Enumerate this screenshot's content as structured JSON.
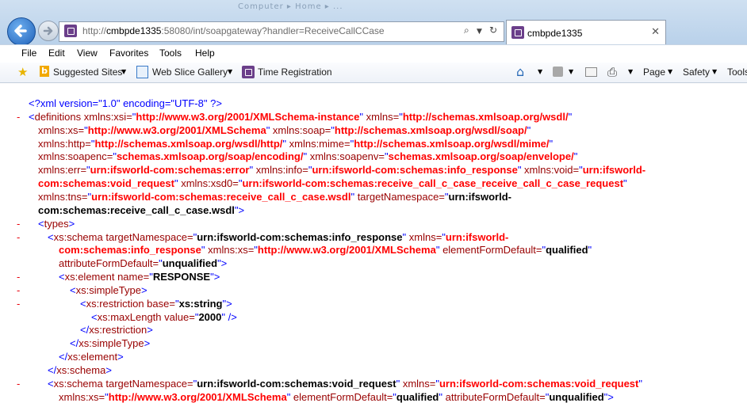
{
  "browser": {
    "address_url_prefix": "http://",
    "address_host": "cmbpde1335",
    "address_rest": ":58080/int/soapgateway?handler=ReceiveCallCCase",
    "tab_title": "cmbpde1335",
    "ghost_title": "Computer ▸ Home ▸ ...",
    "search_icon": "search-icon",
    "refresh_icon": "refresh-icon"
  },
  "menu": [
    "File",
    "Edit",
    "View",
    "Favorites",
    "Tools",
    "Help"
  ],
  "favorites_bar": {
    "suggested_sites": "Suggested Sites",
    "web_slice_gallery": "Web Slice Gallery",
    "time_registration": "Time Registration"
  },
  "command_bar": {
    "page": "Page",
    "safety": "Safety",
    "tools": "Tools"
  },
  "xml_lines": [
    {
      "marker": "",
      "indent": 36,
      "parts": [
        [
          "pi",
          "<?xml version=\"1.0\" encoding=\"UTF-8\" ?>"
        ]
      ]
    },
    {
      "marker": "-",
      "indent": 36,
      "parts": [
        [
          "b",
          "<"
        ],
        [
          "t",
          "definitions"
        ],
        [
          "a",
          " xmlns:xsi="
        ],
        [
          "b",
          "\""
        ],
        [
          "r",
          "http://www.w3.org/2001/XMLSchema-instance"
        ],
        [
          "b",
          "\""
        ],
        [
          "a",
          " xmlns="
        ],
        [
          "b",
          "\""
        ],
        [
          "r",
          "http://schemas.xmlsoap.org/wsdl/"
        ],
        [
          "b",
          "\""
        ]
      ]
    },
    {
      "marker": "",
      "indent": 48,
      "parts": [
        [
          "a",
          "xmlns:xs="
        ],
        [
          "b",
          "\""
        ],
        [
          "r",
          "http://www.w3.org/2001/XMLSchema"
        ],
        [
          "b",
          "\""
        ],
        [
          "a",
          " xmlns:soap="
        ],
        [
          "b",
          "\""
        ],
        [
          "r",
          "http://schemas.xmlsoap.org/wsdl/soap/"
        ],
        [
          "b",
          "\""
        ]
      ]
    },
    {
      "marker": "",
      "indent": 48,
      "parts": [
        [
          "a",
          "xmlns:http="
        ],
        [
          "b",
          "\""
        ],
        [
          "r",
          "http://schemas.xmlsoap.org/wsdl/http/"
        ],
        [
          "b",
          "\""
        ],
        [
          "a",
          " xmlns:mime="
        ],
        [
          "b",
          "\""
        ],
        [
          "r",
          "http://schemas.xmlsoap.org/wsdl/mime/"
        ],
        [
          "b",
          "\""
        ]
      ]
    },
    {
      "marker": "",
      "indent": 48,
      "parts": [
        [
          "a",
          "xmlns:soapenc="
        ],
        [
          "b",
          "\""
        ],
        [
          "r",
          "schemas.xmlsoap.org/soap/encoding/"
        ],
        [
          "b",
          "\""
        ],
        [
          "a",
          " xmlns:soapenv="
        ],
        [
          "b",
          "\""
        ],
        [
          "r",
          "schemas.xmlsoap.org/soap/envelope/"
        ],
        [
          "b",
          "\""
        ]
      ]
    },
    {
      "marker": "",
      "indent": 48,
      "parts": [
        [
          "a",
          "xmlns:err="
        ],
        [
          "b",
          "\""
        ],
        [
          "r",
          "urn:ifsworld-com:schemas:error"
        ],
        [
          "b",
          "\""
        ],
        [
          "a",
          " xmlns:info="
        ],
        [
          "b",
          "\""
        ],
        [
          "r",
          "urn:ifsworld-com:schemas:info_response"
        ],
        [
          "b",
          "\""
        ],
        [
          "a",
          " xmlns:void="
        ],
        [
          "b",
          "\""
        ],
        [
          "r",
          "urn:ifsworld-"
        ]
      ]
    },
    {
      "marker": "",
      "indent": 48,
      "parts": [
        [
          "r",
          "com:schemas:void_request"
        ],
        [
          "b",
          "\""
        ],
        [
          "a",
          " xmlns:xsd0="
        ],
        [
          "b",
          "\""
        ],
        [
          "r",
          "urn:ifsworld-com:schemas:receive_call_c_case_receive_call_c_case_request"
        ],
        [
          "b",
          "\""
        ]
      ]
    },
    {
      "marker": "",
      "indent": 48,
      "parts": [
        [
          "a",
          "xmlns:tns="
        ],
        [
          "b",
          "\""
        ],
        [
          "r",
          "urn:ifsworld-com:schemas:receive_call_c_case.wsdl"
        ],
        [
          "b",
          "\""
        ],
        [
          "a",
          " targetNamespace="
        ],
        [
          "b",
          "\""
        ],
        [
          "v",
          "urn:ifsworld-"
        ]
      ]
    },
    {
      "marker": "",
      "indent": 48,
      "parts": [
        [
          "v",
          "com:schemas:receive_call_c_case.wsdl"
        ],
        [
          "b",
          "\">"
        ]
      ]
    },
    {
      "marker": "-",
      "indent": 48,
      "parts": [
        [
          "b",
          "<"
        ],
        [
          "t",
          "types"
        ],
        [
          "b",
          ">"
        ]
      ]
    },
    {
      "marker": "-",
      "indent": 60,
      "parts": [
        [
          "b",
          "<"
        ],
        [
          "t",
          "xs:schema"
        ],
        [
          "a",
          " targetNamespace="
        ],
        [
          "b",
          "\""
        ],
        [
          "v",
          "urn:ifsworld-com:schemas:info_response"
        ],
        [
          "b",
          "\""
        ],
        [
          "a",
          " xmlns="
        ],
        [
          "b",
          "\""
        ],
        [
          "r",
          "urn:ifsworld-"
        ]
      ]
    },
    {
      "marker": "",
      "indent": 74,
      "parts": [
        [
          "r",
          "com:schemas:info_response"
        ],
        [
          "b",
          "\""
        ],
        [
          "a",
          " xmlns:xs="
        ],
        [
          "b",
          "\""
        ],
        [
          "r",
          "http://www.w3.org/2001/XMLSchema"
        ],
        [
          "b",
          "\""
        ],
        [
          "a",
          " elementFormDefault="
        ],
        [
          "b",
          "\""
        ],
        [
          "v",
          "qualified"
        ],
        [
          "b",
          "\""
        ]
      ]
    },
    {
      "marker": "",
      "indent": 74,
      "parts": [
        [
          "a",
          "attributeFormDefault="
        ],
        [
          "b",
          "\""
        ],
        [
          "v",
          "unqualified"
        ],
        [
          "b",
          "\">"
        ]
      ]
    },
    {
      "marker": "-",
      "indent": 74,
      "parts": [
        [
          "b",
          "<"
        ],
        [
          "t",
          "xs:element"
        ],
        [
          "a",
          " name="
        ],
        [
          "b",
          "\""
        ],
        [
          "v",
          "RESPONSE"
        ],
        [
          "b",
          "\">"
        ]
      ]
    },
    {
      "marker": "-",
      "indent": 88,
      "parts": [
        [
          "b",
          "<"
        ],
        [
          "t",
          "xs:simpleType"
        ],
        [
          "b",
          ">"
        ]
      ]
    },
    {
      "marker": "-",
      "indent": 101,
      "parts": [
        [
          "b",
          "<"
        ],
        [
          "t",
          "xs:restriction"
        ],
        [
          "a",
          " base="
        ],
        [
          "b",
          "\""
        ],
        [
          "v",
          "xs:string"
        ],
        [
          "b",
          "\">"
        ]
      ]
    },
    {
      "marker": "",
      "indent": 115,
      "parts": [
        [
          "b",
          "<"
        ],
        [
          "t",
          "xs:maxLength"
        ],
        [
          "a",
          " value="
        ],
        [
          "b",
          "\""
        ],
        [
          "v",
          "2000"
        ],
        [
          "b",
          "\" />"
        ]
      ]
    },
    {
      "marker": "",
      "indent": 101,
      "parts": [
        [
          "b",
          "</"
        ],
        [
          "t",
          "xs:restriction"
        ],
        [
          "b",
          ">"
        ]
      ]
    },
    {
      "marker": "",
      "indent": 88,
      "parts": [
        [
          "b",
          "</"
        ],
        [
          "t",
          "xs:simpleType"
        ],
        [
          "b",
          ">"
        ]
      ]
    },
    {
      "marker": "",
      "indent": 74,
      "parts": [
        [
          "b",
          "</"
        ],
        [
          "t",
          "xs:element"
        ],
        [
          "b",
          ">"
        ]
      ]
    },
    {
      "marker": "",
      "indent": 60,
      "parts": [
        [
          "b",
          "</"
        ],
        [
          "t",
          "xs:schema"
        ],
        [
          "b",
          ">"
        ]
      ]
    },
    {
      "marker": "-",
      "indent": 60,
      "parts": [
        [
          "b",
          "<"
        ],
        [
          "t",
          "xs:schema"
        ],
        [
          "a",
          " targetNamespace="
        ],
        [
          "b",
          "\""
        ],
        [
          "v",
          "urn:ifsworld-com:schemas:void_request"
        ],
        [
          "b",
          "\""
        ],
        [
          "a",
          " xmlns="
        ],
        [
          "b",
          "\""
        ],
        [
          "r",
          "urn:ifsworld-com:schemas:void_request"
        ],
        [
          "b",
          "\""
        ]
      ]
    },
    {
      "marker": "",
      "indent": 74,
      "parts": [
        [
          "a",
          "xmlns:xs="
        ],
        [
          "b",
          "\""
        ],
        [
          "r",
          "http://www.w3.org/2001/XMLSchema"
        ],
        [
          "b",
          "\""
        ],
        [
          "a",
          " elementFormDefault="
        ],
        [
          "b",
          "\""
        ],
        [
          "v",
          "qualified"
        ],
        [
          "b",
          "\""
        ],
        [
          "a",
          " attributeFormDefault="
        ],
        [
          "b",
          "\""
        ],
        [
          "v",
          "unqualified"
        ],
        [
          "b",
          "\">"
        ]
      ]
    }
  ]
}
